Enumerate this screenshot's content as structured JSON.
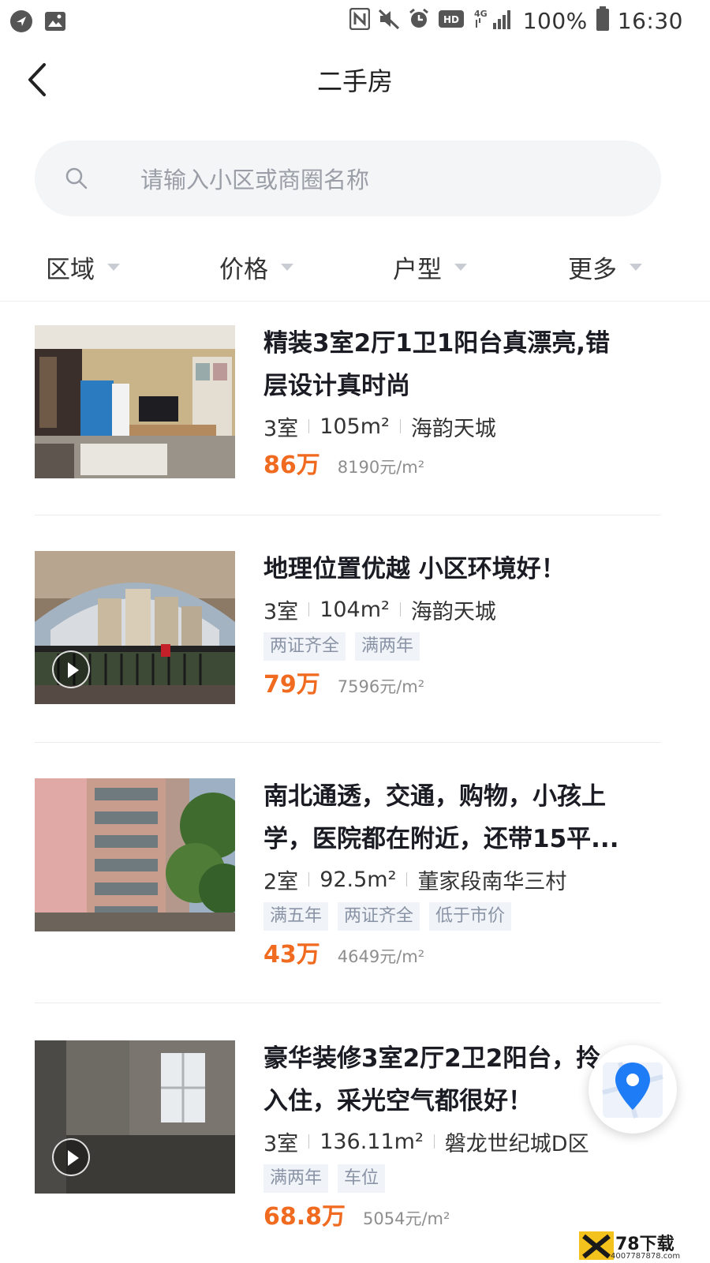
{
  "status_bar": {
    "battery": "100%",
    "time": "16:30",
    "network": "4G",
    "hd_label": "HD",
    "icons": [
      "navigation-icon",
      "image-icon",
      "nfc-icon",
      "mute-icon",
      "alarm-icon",
      "hd-icon",
      "signal-icon",
      "battery-icon"
    ]
  },
  "nav": {
    "title": "二手房",
    "back_icon": "chevron-left-icon"
  },
  "search": {
    "placeholder": "请输入小区或商圈名称",
    "icon": "search-icon"
  },
  "filters": [
    {
      "label": "区域"
    },
    {
      "label": "价格"
    },
    {
      "label": "户型"
    },
    {
      "label": "更多"
    }
  ],
  "listings": [
    {
      "title_lines": [
        "精装3室2厅1卫1阳台真漂亮,错",
        "层设计真时尚"
      ],
      "rooms": "3室",
      "area": "105m²",
      "community": "海韵天城",
      "tags": [],
      "price": "86万",
      "unit_price": "8190元/m²",
      "has_video": false
    },
    {
      "title_lines": [
        "地理位置优越 小区环境好！"
      ],
      "rooms": "3室",
      "area": "104m²",
      "community": "海韵天城",
      "tags": [
        "两证齐全",
        "满两年"
      ],
      "price": "79万",
      "unit_price": "7596元/m²",
      "has_video": true
    },
    {
      "title_lines": [
        "南北通透，交通，购物，小孩上",
        "学，医院都在附近，还带15平..."
      ],
      "rooms": "2室",
      "area": "92.5m²",
      "community": "董家段南华三村",
      "tags": [
        "满五年",
        "两证齐全",
        "低于市价"
      ],
      "price": "43万",
      "unit_price": "4649元/m²",
      "has_video": false
    },
    {
      "title_lines": [
        "豪华装修3室2厅2卫2阳台，拎",
        "入住，采光空气都很好！"
      ],
      "rooms": "3室",
      "area": "136.11m²",
      "community": "磐龙世纪城D区",
      "tags": [
        "满两年",
        "车位"
      ],
      "price": "68.8万",
      "unit_price": "5054元/m²",
      "has_video": true
    }
  ],
  "map_button": {
    "icon": "map-pin-icon"
  },
  "watermark": {
    "text": "78下载",
    "sub": "4007787878.com"
  },
  "colors": {
    "accent_price": "#f06a1f",
    "map_pin": "#1e7cf7",
    "tag_text": "#8a94a6"
  }
}
